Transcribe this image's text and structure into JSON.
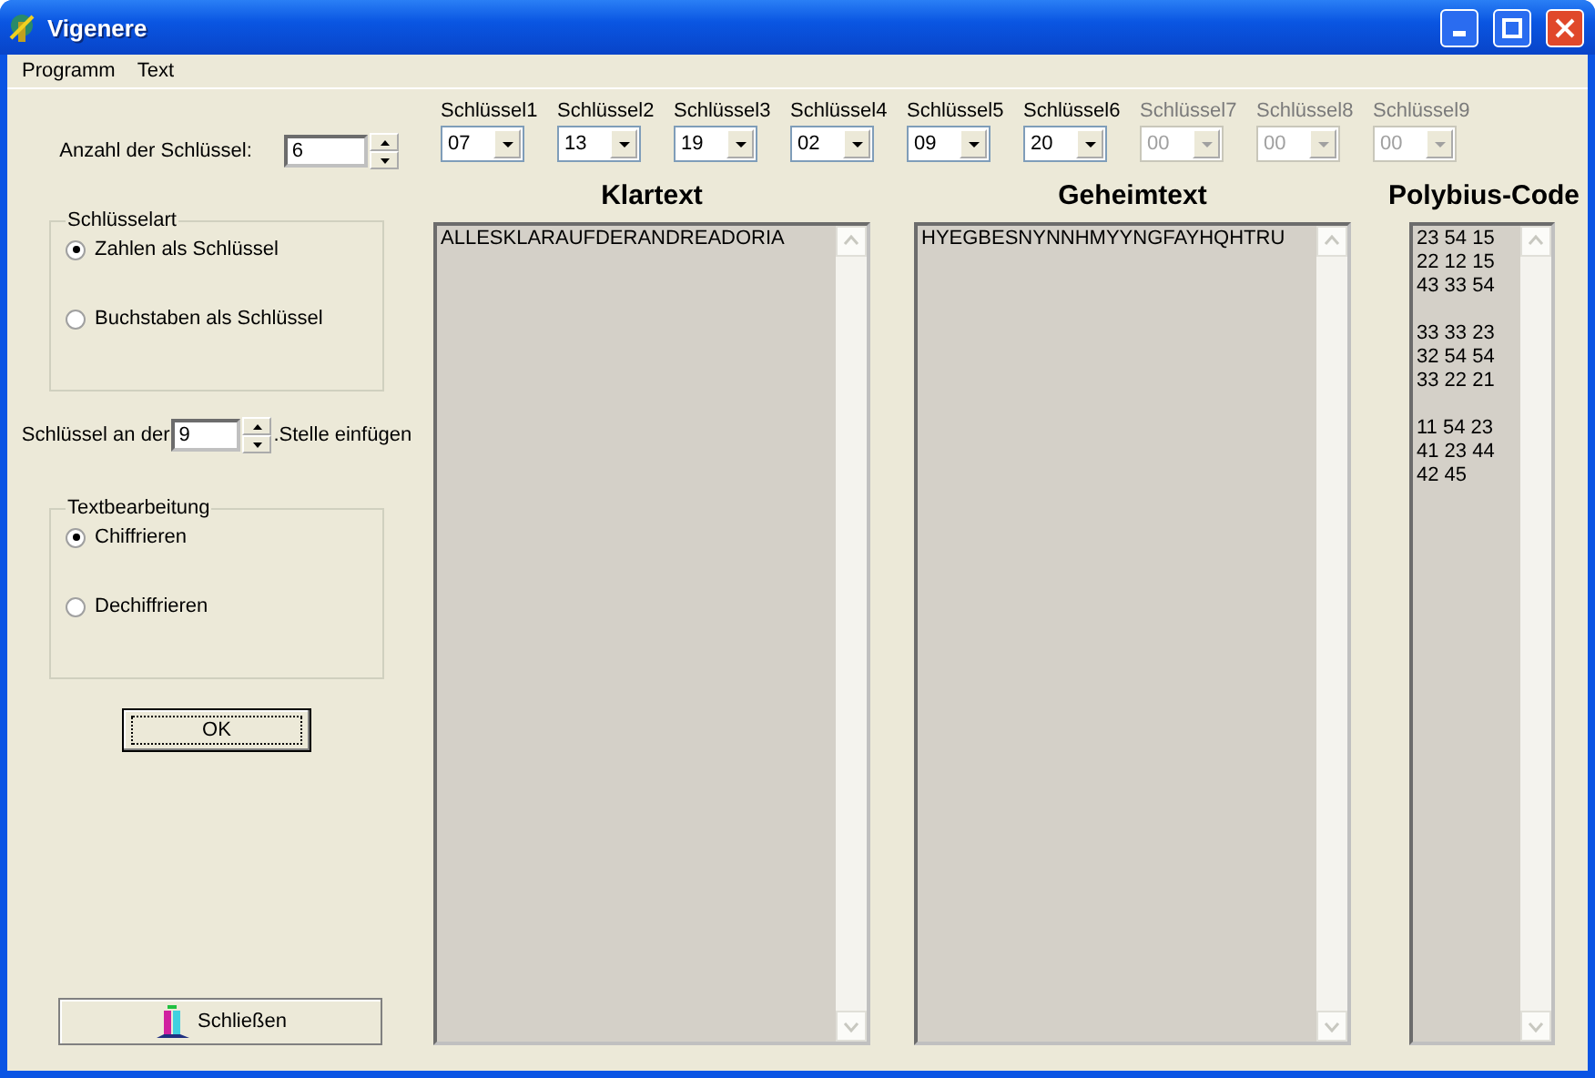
{
  "window": {
    "title": "Vigenere"
  },
  "menu": [
    "Programm",
    "Text"
  ],
  "key_count": {
    "label": "Anzahl der Schlüssel:",
    "value": "6"
  },
  "keys": [
    {
      "label": "Schlüssel1",
      "value": "07",
      "disabled": false
    },
    {
      "label": "Schlüssel2",
      "value": "13",
      "disabled": false
    },
    {
      "label": "Schlüssel3",
      "value": "19",
      "disabled": false
    },
    {
      "label": "Schlüssel4",
      "value": "02",
      "disabled": false
    },
    {
      "label": "Schlüssel5",
      "value": "09",
      "disabled": false
    },
    {
      "label": "Schlüssel6",
      "value": "20",
      "disabled": false
    },
    {
      "label": "Schlüssel7",
      "value": "00",
      "disabled": true
    },
    {
      "label": "Schlüssel8",
      "value": "00",
      "disabled": true
    },
    {
      "label": "Schlüssel9",
      "value": "00",
      "disabled": true
    }
  ],
  "key_type": {
    "title": "Schlüsselart",
    "options": [
      {
        "label": "Zahlen als Schlüssel",
        "selected": true
      },
      {
        "label": "Buchstaben als Schlüssel",
        "selected": false
      }
    ]
  },
  "insert_position": {
    "before": "Schlüssel an der",
    "value": "9",
    "after": ".Stelle einfügen"
  },
  "text_mode": {
    "title": "Textbearbeitung",
    "options": [
      {
        "label": "Chiffrieren",
        "selected": true
      },
      {
        "label": "Dechiffrieren",
        "selected": false
      }
    ]
  },
  "ok_button": "OK",
  "close_button": "Schließen",
  "panels": [
    {
      "title": "Klartext",
      "text": "ALLESKLARAUFDERANDREADORIA",
      "kind": "wide"
    },
    {
      "title": "Geheimtext",
      "text": "HYEGBESNYNNHMYYNGFAYHQHTRU",
      "kind": "wide"
    },
    {
      "title": "Polybius-Code",
      "text": "23 54 15\n22 12 15\n43 33 54\n\n33 33 23\n32 54 54\n33 22 21\n\n11 54 23\n41 23 44\n42 45",
      "kind": "narrow"
    }
  ]
}
